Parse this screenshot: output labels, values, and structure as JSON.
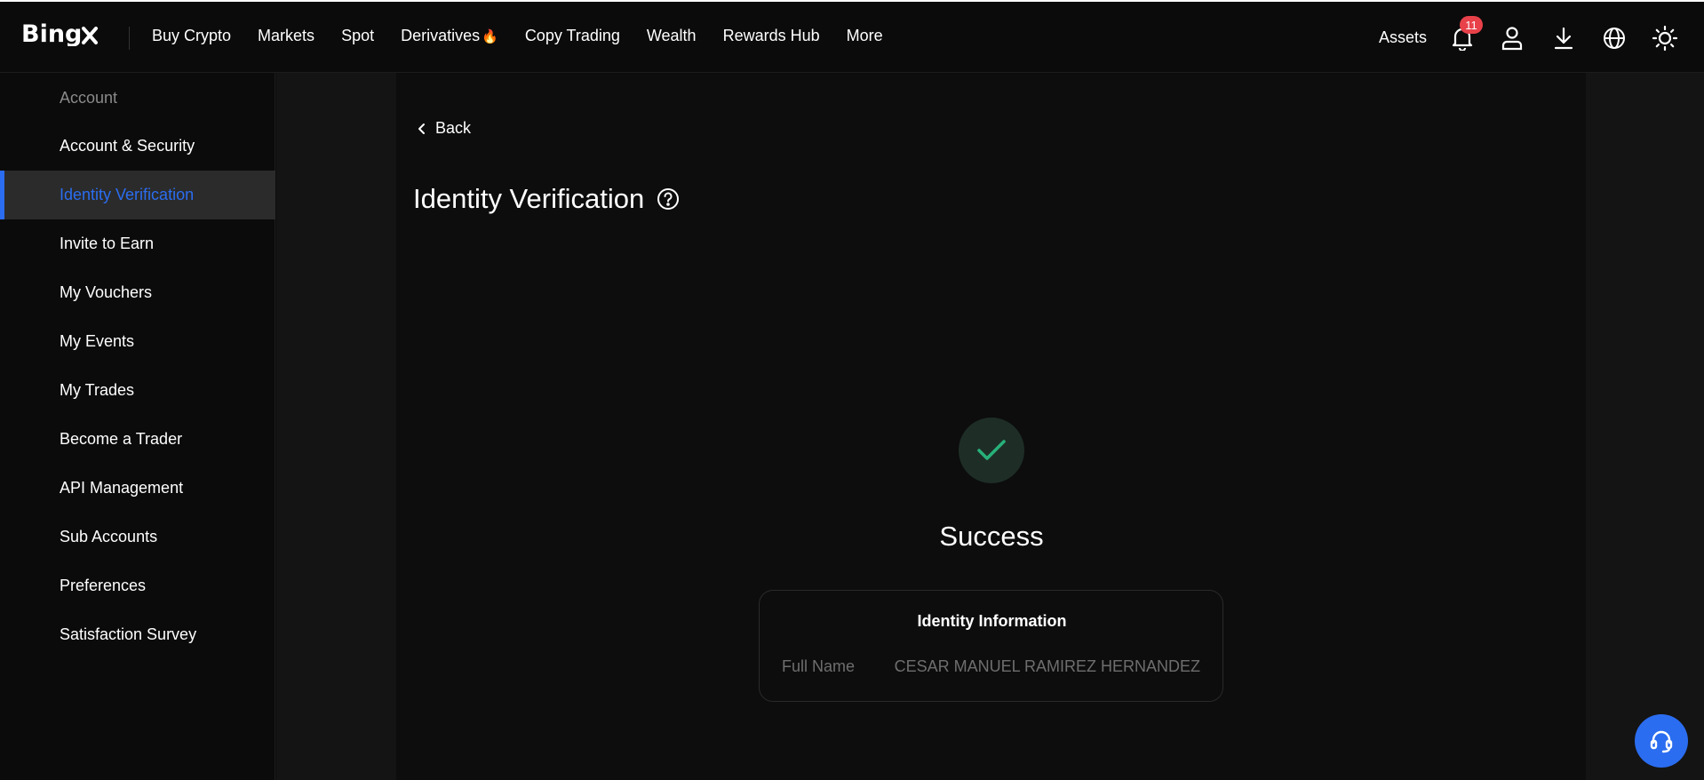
{
  "brand": {
    "logo_text": "BingX"
  },
  "nav": {
    "items": [
      {
        "label": "Buy Crypto"
      },
      {
        "label": "Markets"
      },
      {
        "label": "Spot"
      },
      {
        "label": "Derivatives",
        "flame": "🔥"
      },
      {
        "label": "Copy Trading"
      },
      {
        "label": "Wealth"
      },
      {
        "label": "Rewards Hub"
      },
      {
        "label": "More"
      }
    ]
  },
  "header_right": {
    "assets_label": "Assets",
    "notification_count": "11",
    "icons": [
      "bell-icon",
      "user-icon",
      "download-icon",
      "globe-icon",
      "sun-icon"
    ]
  },
  "sidebar": {
    "heading": "Account",
    "items": [
      {
        "label": "Account & Security"
      },
      {
        "label": "Identity Verification",
        "active": true
      },
      {
        "label": "Invite to Earn"
      },
      {
        "label": "My Vouchers"
      },
      {
        "label": "My Events"
      },
      {
        "label": "My Trades"
      },
      {
        "label": "Become a Trader"
      },
      {
        "label": "API Management"
      },
      {
        "label": "Sub Accounts"
      },
      {
        "label": "Preferences"
      },
      {
        "label": "Satisfaction Survey"
      }
    ]
  },
  "main": {
    "back_label": "Back",
    "title": "Identity Verification",
    "status_text": "Success",
    "card": {
      "title": "Identity Information",
      "rows": [
        {
          "label": "Full Name",
          "value": "CESAR MANUEL RAMIREZ HERNANDEZ"
        }
      ]
    }
  },
  "colors": {
    "accent": "#2b6df0",
    "success": "#27b27a",
    "badge": "#e8414a",
    "background": "#0d0d0d"
  }
}
